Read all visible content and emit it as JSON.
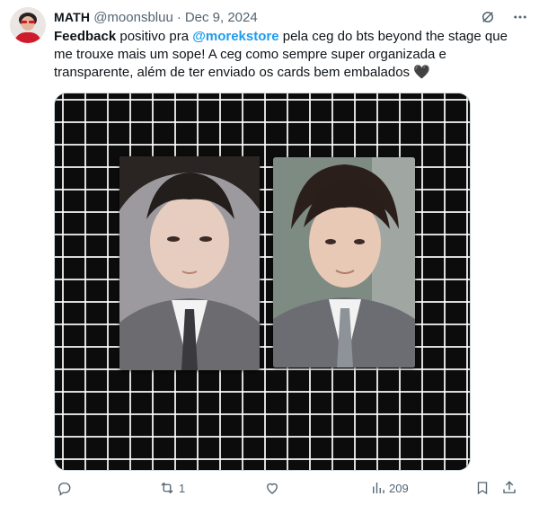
{
  "tweet": {
    "author_name": "MATH",
    "handle": "@moonsbluu",
    "separator": "·",
    "date": "Dec 9, 2024",
    "text_segments": {
      "bold_lead": "Feedback",
      "part1": " positivo pra ",
      "mention": "@morekstore",
      "part2": " pela ceg do bts beyond the stage que me trouxe mais um sope! A ceg como sempre super organizada e transparente, além de ter enviado os cards bem embalados ",
      "emoji": "🖤"
    }
  },
  "header_icons": [
    "grok-icon",
    "more-icon"
  ],
  "media": {
    "cards": [
      "photocard-1",
      "photocard-2"
    ]
  },
  "actions": {
    "reply_count": "",
    "retweet_count": "1",
    "like_count": "",
    "views_count": "209"
  },
  "colors": {
    "accent": "#1d9bf0",
    "secondary_text": "#536471",
    "primary_text": "#0f1419"
  }
}
